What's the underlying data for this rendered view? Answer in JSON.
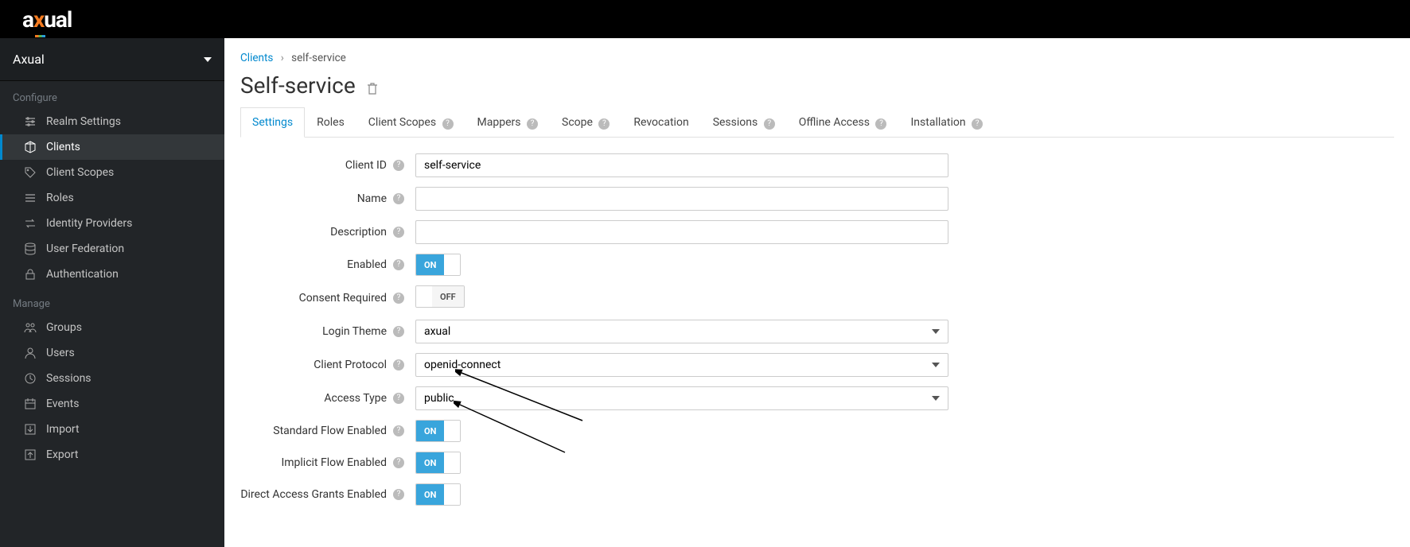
{
  "logo": {
    "part1": "a",
    "part2": "x",
    "part3": "ual"
  },
  "realm": {
    "name": "Axual"
  },
  "sidebar": {
    "section_configure": "Configure",
    "section_manage": "Manage",
    "configure_items": [
      {
        "label": "Realm Settings",
        "icon": "sliders"
      },
      {
        "label": "Clients",
        "icon": "cube",
        "active": true
      },
      {
        "label": "Client Scopes",
        "icon": "tags"
      },
      {
        "label": "Roles",
        "icon": "list"
      },
      {
        "label": "Identity Providers",
        "icon": "exchange"
      },
      {
        "label": "User Federation",
        "icon": "database"
      },
      {
        "label": "Authentication",
        "icon": "lock"
      }
    ],
    "manage_items": [
      {
        "label": "Groups",
        "icon": "users"
      },
      {
        "label": "Users",
        "icon": "user"
      },
      {
        "label": "Sessions",
        "icon": "clock"
      },
      {
        "label": "Events",
        "icon": "calendar"
      },
      {
        "label": "Import",
        "icon": "download"
      },
      {
        "label": "Export",
        "icon": "upload"
      }
    ]
  },
  "breadcrumb": {
    "root": "Clients",
    "current": "self-service"
  },
  "page": {
    "title": "Self-service"
  },
  "tabs": [
    {
      "label": "Settings",
      "active": true,
      "help": false
    },
    {
      "label": "Roles",
      "help": false
    },
    {
      "label": "Client Scopes",
      "help": true
    },
    {
      "label": "Mappers",
      "help": true
    },
    {
      "label": "Scope",
      "help": true
    },
    {
      "label": "Revocation",
      "help": false
    },
    {
      "label": "Sessions",
      "help": true
    },
    {
      "label": "Offline Access",
      "help": true
    },
    {
      "label": "Installation",
      "help": true
    }
  ],
  "form": {
    "client_id": {
      "label": "Client ID",
      "value": "self-service"
    },
    "name": {
      "label": "Name",
      "value": ""
    },
    "description": {
      "label": "Description",
      "value": ""
    },
    "enabled": {
      "label": "Enabled",
      "value": "ON"
    },
    "consent_required": {
      "label": "Consent Required",
      "value": "OFF"
    },
    "login_theme": {
      "label": "Login Theme",
      "value": "axual"
    },
    "client_protocol": {
      "label": "Client Protocol",
      "value": "openid-connect"
    },
    "access_type": {
      "label": "Access Type",
      "value": "public"
    },
    "standard_flow": {
      "label": "Standard Flow Enabled",
      "value": "ON"
    },
    "implicit_flow": {
      "label": "Implicit Flow Enabled",
      "value": "ON"
    },
    "direct_access": {
      "label": "Direct Access Grants Enabled",
      "value": "ON"
    }
  },
  "toggle_labels": {
    "on": "ON",
    "off": "OFF"
  }
}
